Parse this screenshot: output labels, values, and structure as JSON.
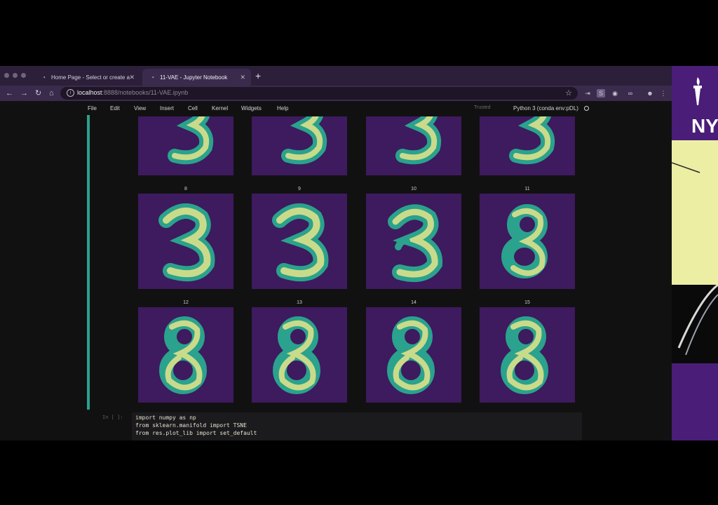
{
  "browser": {
    "tabs": [
      {
        "label": "Home Page - Select or create a",
        "active": false
      },
      {
        "label": "11-VAE - Jupyter Notebook",
        "active": true
      }
    ],
    "url_host": "localhost",
    "url_path": ":8888/notebooks/11-VAE.ipynb"
  },
  "jupyter": {
    "menu": [
      "File",
      "Edit",
      "View",
      "Insert",
      "Cell",
      "Kernel",
      "Widgets",
      "Help"
    ],
    "trusted": "Trusted",
    "kernel": "Python 3 (conda env:pDL)"
  },
  "digits": {
    "row1_labels": [
      "8",
      "9",
      "10",
      "11"
    ],
    "row2_labels": [
      "12",
      "13",
      "14",
      "15"
    ]
  },
  "code_cell": {
    "prompt": "In [ ]:",
    "lines": [
      "import numpy as np",
      "from sklearn.manifold import TSNE",
      "from res.plot_lib import set_default"
    ]
  },
  "overlay": {
    "text": "NY"
  },
  "colors": {
    "panel_bg": "#3e1a5e",
    "digit_fill": "#2aa28d",
    "digit_core": "#c9db8a",
    "cell_bar": "#2aa28d",
    "overlay_purple": "#4a1d78"
  }
}
